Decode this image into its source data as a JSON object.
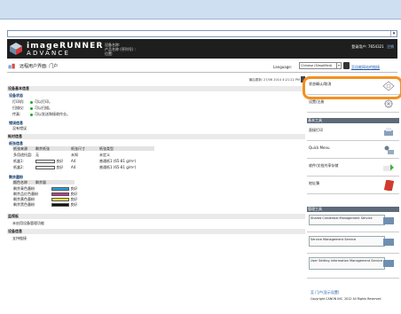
{
  "header": {
    "brand_line1": "imageRUNNER",
    "brand_line2": "ADVANCE",
    "device_name_label": "设备名称:",
    "product_name_label": "产品名称 (序列号) :",
    "location_label": "位置:",
    "login_user": "登录用户: 7654321",
    "logout_label": "注销"
  },
  "toolbar": {
    "portal_title": "远程用户界面: 门户",
    "language_label": "Language:",
    "language_value": "Chinese (Simplified)",
    "site_link": "至佳能网站的链接"
  },
  "main": {
    "last_update": "最后更新: 27/06 2014 4:21:22 PM",
    "sections": {
      "device_basic": "设备基本信息",
      "device_status": "设备状态",
      "error_info": "错误信息",
      "consumables": "耗材信息",
      "paper_info": "纸张信息",
      "toner_info": "剩余墨粉",
      "consumable_error": "监视板",
      "device_info": "设备信息"
    },
    "status_rows": [
      {
        "label": "打印机:",
        "value": "可以打印。"
      },
      {
        "label": "扫描仪:",
        "value": "可以扫描。"
      },
      {
        "label": "传真:",
        "value": "可以发送和接收作业。"
      }
    ],
    "error_text": "没有错误",
    "paper_headers": [
      "纸张来源",
      "剩余纸张",
      "纸张尺寸",
      "纸张类型"
    ],
    "paper_rows": [
      [
        "多用途托盘:",
        "无",
        "未知",
        "未定义"
      ],
      [
        "纸盒1:",
        "",
        "良好",
        "A4",
        "普通纸1 (65-81 g/m²)"
      ],
      [
        "纸盒2:",
        "",
        "良好",
        "A4",
        "普通纸1 (65-81 g/m²)"
      ]
    ],
    "toner_headers": [
      "颜色名称",
      "剩余量"
    ],
    "toner_rows": [
      {
        "name": "剩余青色墨粉",
        "value": "良好",
        "color": "#1fa8e0"
      },
      {
        "name": "剩余品红色墨粉",
        "value": "良好",
        "color": "#c0398e"
      },
      {
        "name": "剩余黄色墨粉",
        "value": "良好",
        "color": "#f2e23a"
      },
      {
        "name": "剩余黑色墨粉",
        "value": "良好",
        "color": "#111111"
      }
    ],
    "consumable_text": "未启用设备管理功能",
    "device_info_text": "支持链接"
  },
  "sidebar": {
    "items_top": [
      {
        "label": "状态确认/取消",
        "icon": "status-monitor-icon"
      },
      {
        "label": "设置/注册",
        "icon": "settings-icon"
      }
    ],
    "basic_tools_title": "基本工具",
    "basic_items": [
      {
        "label": "直接打印",
        "icon": "direct-print-icon"
      },
      {
        "label": "Quick Menu",
        "icon": "quick-menu-icon"
      },
      {
        "label": "收件/文档共享存储",
        "icon": "mail-box-icon"
      },
      {
        "label": "地址簿",
        "icon": "address-book-icon"
      }
    ],
    "mgmt_title": "管理工具",
    "mgmt_items": [
      "Shared Credential Management Service",
      "Service Management Service",
      "User Setting Information Management Service"
    ],
    "footer_link": "至 门户(显示设置)",
    "copyright": "Copyright CANON INC. 2012 All Rights Reserved"
  }
}
